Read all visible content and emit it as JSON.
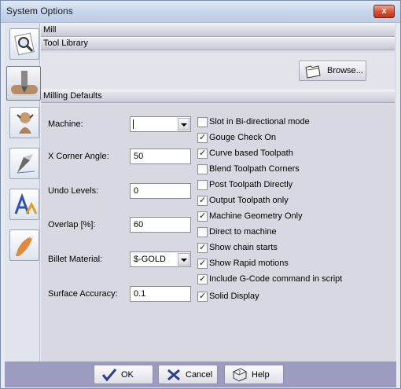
{
  "window": {
    "title": "System Options",
    "close_glyph": "x"
  },
  "sections": {
    "mill": "Mill",
    "tool_library": "Tool Library",
    "milling_defaults": "Milling Defaults"
  },
  "browse": {
    "label": "Browse..."
  },
  "fields": {
    "machine": {
      "label": "Machine:",
      "value": ""
    },
    "x_corner_angle": {
      "label": "X Corner Angle:",
      "value": "50"
    },
    "undo_levels": {
      "label": "Undo Levels:",
      "value": "0"
    },
    "overlap": {
      "label": "Overlap [%]:",
      "value": "60"
    },
    "billet_material": {
      "label": "Billet Material:",
      "value": "$-GOLD"
    },
    "surface_accuracy": {
      "label": "Surface Accuracy:",
      "value": "0.1"
    }
  },
  "options": [
    {
      "label": "Slot in Bi-directional mode",
      "checked": false
    },
    {
      "label": "Gouge Check On",
      "checked": true
    },
    {
      "label": "Curve based Toolpath",
      "checked": true
    },
    {
      "label": "Blend Toolpath Corners",
      "checked": false
    },
    {
      "label": "Post Toolpath Directly",
      "checked": false
    },
    {
      "label": "Output Toolpath only",
      "checked": true
    },
    {
      "label": "Machine Geometry Only",
      "checked": true
    },
    {
      "label": "Direct to machine",
      "checked": false
    },
    {
      "label": "Show chain starts",
      "checked": true
    },
    {
      "label": "Show Rapid motions",
      "checked": true
    },
    {
      "label": "Include G-Code command in script",
      "checked": true
    },
    {
      "label": "Solid Display",
      "checked": true
    }
  ],
  "buttons": {
    "ok": "OK",
    "cancel": "Cancel",
    "help": "Help"
  },
  "colors": {
    "bottom_bar": "#9c9cc0",
    "header": "#c9c9d6",
    "close": "#d5553b"
  },
  "sidebar_icons": [
    "search-document-icon",
    "mill-tool-icon",
    "statue-icon",
    "pen-nib-icon",
    "text-style-icon",
    "carving-blade-icon"
  ]
}
